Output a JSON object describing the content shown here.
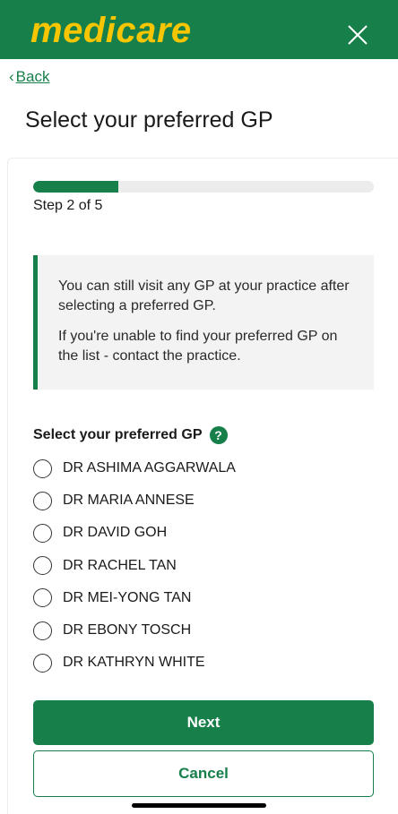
{
  "header": {
    "logo_text": "medicare",
    "close_icon": "close-icon",
    "brand_color": "#167f4a",
    "logo_color": "#f7c600"
  },
  "nav": {
    "back_chevron": "‹",
    "back_label": "Back"
  },
  "page": {
    "title": "Select your preferred GP"
  },
  "progress": {
    "step_label": "Step 2 of 5",
    "fraction": 0.25
  },
  "info": {
    "line1": "You can still visit any GP at your practice after selecting a preferred GP.",
    "line2": "If you're unable to find your preferred GP on the list - contact the practice."
  },
  "form": {
    "question": "Select your preferred GP",
    "help_icon": "?",
    "options": [
      "DR ASHIMA AGGARWALA",
      "DR MARIA ANNESE",
      "DR DAVID GOH",
      "DR RACHEL TAN",
      "DR MEI-YONG TAN",
      "DR EBONY TOSCH",
      "DR KATHRYN WHITE"
    ]
  },
  "actions": {
    "next_label": "Next",
    "cancel_label": "Cancel"
  }
}
